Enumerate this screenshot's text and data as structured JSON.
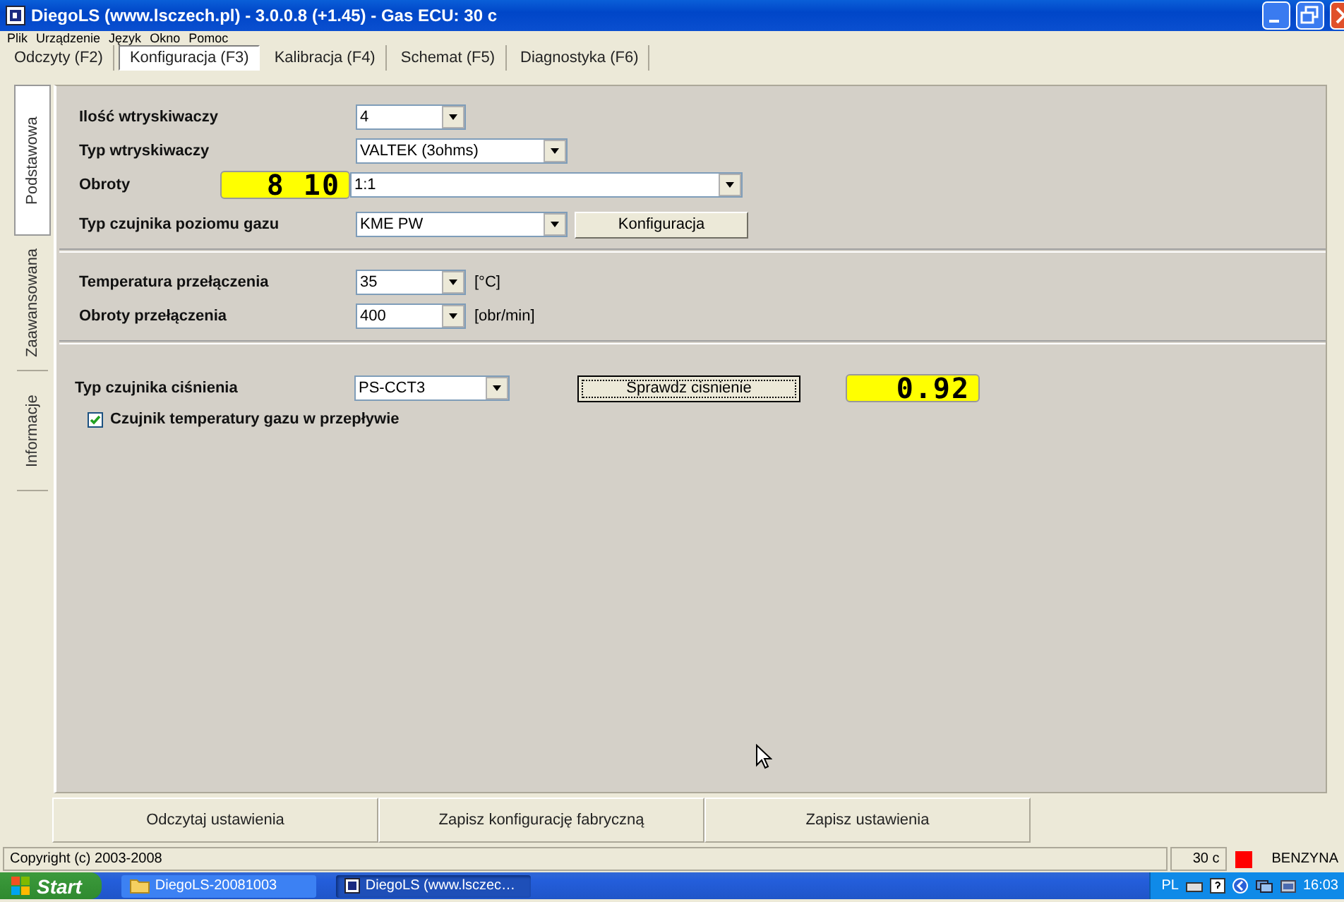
{
  "window": {
    "title": "DiegoLS (www.lsczech.pl) - 3.0.0.8 (+1.45) - Gas ECU: 30 c"
  },
  "menu": [
    "Plik",
    "Urządzenie",
    "Język",
    "Okno",
    "Pomoc"
  ],
  "tabs": [
    {
      "label": "Odczyty (F2)",
      "selected": false
    },
    {
      "label": "Konfiguracja (F3)",
      "selected": true
    },
    {
      "label": "Kalibracja (F4)",
      "selected": false
    },
    {
      "label": "Schemat (F5)",
      "selected": false
    },
    {
      "label": "Diagnostyka (F6)",
      "selected": false
    }
  ],
  "side_tabs": [
    {
      "label": "Podstawowa",
      "selected": true
    },
    {
      "label": "Zaawansowana",
      "selected": false
    },
    {
      "label": "Informacje",
      "selected": false
    }
  ],
  "rows": [
    {
      "kind": "combo",
      "label": "Ilość wtryskiwaczy",
      "value": "4"
    },
    {
      "kind": "combo",
      "label": "Typ wtryskiwaczy",
      "value": "VALTEK (3ohms)"
    },
    {
      "kind": "combo",
      "label": "Obroty",
      "value": "1:1",
      "lcd": "8 10"
    },
    {
      "kind": "combo",
      "label": "Typ czujnika poziomu gazu",
      "value": "KME PW",
      "button": "Konfiguracja"
    },
    {
      "kind": "separator"
    },
    {
      "kind": "combo",
      "label": "Temperatura przełączenia",
      "value": "35",
      "unit": "[°C]"
    },
    {
      "kind": "combo",
      "label": "Obroty przełączenia",
      "value": "400",
      "unit": "[obr/min]"
    },
    {
      "kind": "separator"
    },
    {
      "kind": "combo",
      "label": "Typ czujnika ciśnienia",
      "value": "PS-CCT3",
      "button": "Sprawdz cisnienie",
      "lcd": "0.92"
    },
    {
      "kind": "checkbox",
      "label": "Czujnik temperatury gazu w przepływie",
      "checked": true
    }
  ],
  "actions": [
    "Odczytaj ustawienia",
    "Zapisz konfigurację fabryczną",
    "Zapisz ustawienia"
  ],
  "status_bar": {
    "copyright": "Copyright (c) 2003-2008",
    "ecu": "30 c",
    "indicator": {
      "color": "#ff0000"
    },
    "fuel": "BENZYNA"
  },
  "taskbar": {
    "start": "Start",
    "tasks": [
      {
        "label": "DiegoLS-20081003",
        "selected": false
      },
      {
        "label": "DiegoLS (www.lsczec…",
        "selected": true
      }
    ],
    "language": "PL",
    "clock": "16:03"
  }
}
